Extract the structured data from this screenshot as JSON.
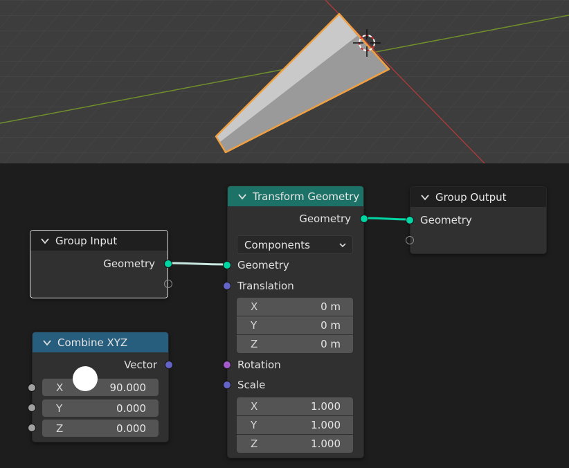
{
  "viewport": {
    "icon": "3d-cursor-icon"
  },
  "nodes": {
    "group_input": {
      "title": "Group Input",
      "outputs": [
        "Geometry"
      ]
    },
    "combine_xyz": {
      "title": "Combine XYZ",
      "output": "Vector",
      "fields": [
        {
          "label": "X",
          "value": "90.000"
        },
        {
          "label": "Y",
          "value": "0.000"
        },
        {
          "label": "Z",
          "value": "0.000"
        }
      ]
    },
    "transform_geometry": {
      "title": "Transform Geometry",
      "output": "Geometry",
      "mode": "Components",
      "geometry_input": "Geometry",
      "translation": {
        "label": "Translation",
        "fields": [
          {
            "label": "X",
            "value": "0 m"
          },
          {
            "label": "Y",
            "value": "0 m"
          },
          {
            "label": "Z",
            "value": "0 m"
          }
        ]
      },
      "rotation_label": "Rotation",
      "scale": {
        "label": "Scale",
        "fields": [
          {
            "label": "X",
            "value": "1.000"
          },
          {
            "label": "Y",
            "value": "1.000"
          },
          {
            "label": "Z",
            "value": "1.000"
          }
        ]
      }
    },
    "group_output": {
      "title": "Group Output",
      "inputs": [
        "Geometry"
      ]
    }
  },
  "colors": {
    "geometry_socket": "#00d6a3",
    "vector_socket": "#6464c8",
    "rotation_socket": "#a45acb",
    "float_socket": "#a1a1a1",
    "selection_outline": "#f0a040"
  }
}
